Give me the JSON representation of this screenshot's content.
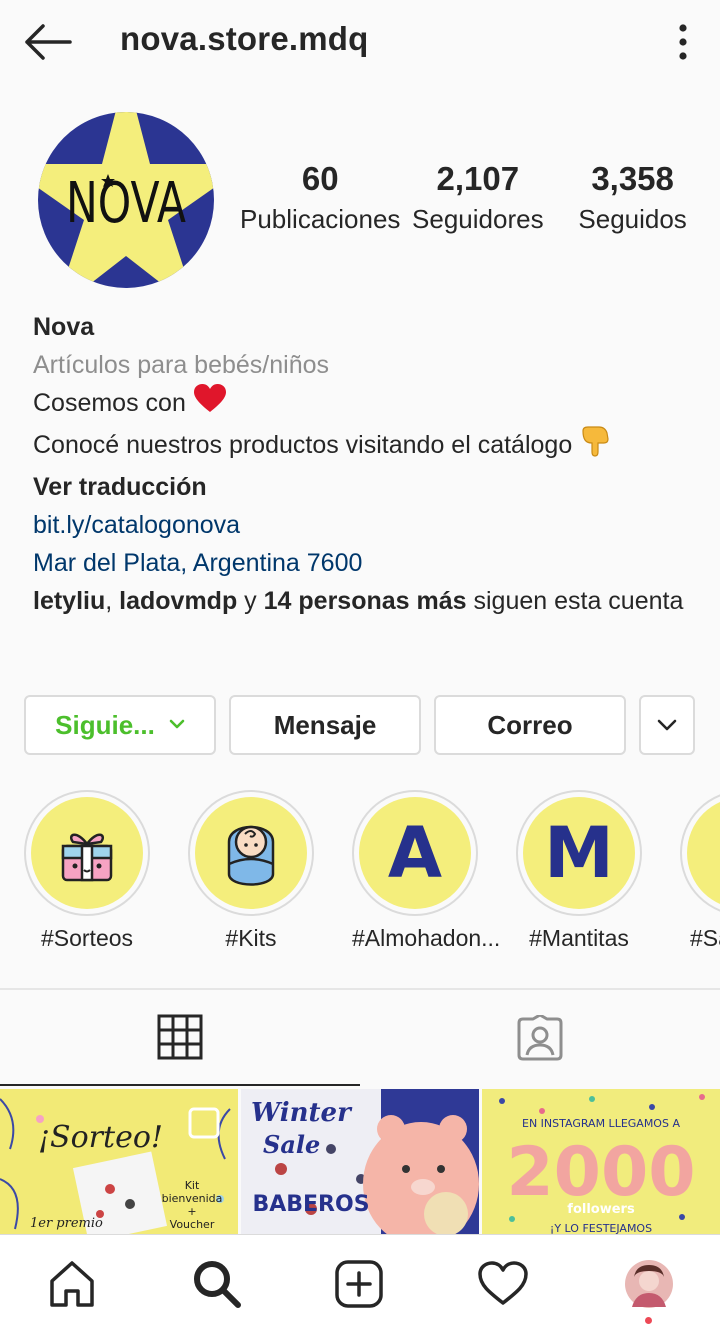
{
  "header": {
    "username": "nova.store.mdq",
    "back_icon": "arrow-left-icon",
    "menu_icon": "more-vertical-icon"
  },
  "profile": {
    "avatar_text": "NOVA",
    "stats": [
      {
        "value": "60",
        "label": "Publicaciones"
      },
      {
        "value": "2,107",
        "label": "Seguidores"
      },
      {
        "value": "3,358",
        "label": "Seguidos"
      }
    ]
  },
  "bio": {
    "name": "Nova",
    "category": "Artículos para bebés/niños",
    "line1": "Cosemos con",
    "line2": "Conocé nuestros productos visitando el catálogo",
    "translate": "Ver traducción",
    "link": "bit.ly/catalogonova",
    "location": "Mar del Plata, Argentina 7600",
    "followed_by_user1": "letyliu",
    "followed_sep1": ", ",
    "followed_by_user2": "ladovmdp",
    "followed_sep2": " y ",
    "followed_by_more": "14 personas más",
    "followed_suffix": " siguen esta cuenta"
  },
  "buttons": {
    "follow": "Siguie...",
    "message": "Mensaje",
    "email": "Correo"
  },
  "highlights": [
    {
      "label": "#Sorteos",
      "icon": "gift-icon"
    },
    {
      "label": "#Kits",
      "icon": "baby-icon"
    },
    {
      "label": "#Almohadon...",
      "letter": "A"
    },
    {
      "label": "#Mantitas",
      "letter": "M"
    },
    {
      "label": "#Sa",
      "icon": ""
    }
  ],
  "posts": [
    {
      "title": "¡Sorteo!",
      "sub1": "Kit",
      "sub2": "bienvenida",
      "sub3": "+",
      "sub4": "Voucher",
      "corner": "1er premio"
    },
    {
      "title1": "Winter",
      "title2": "Sale",
      "tag": "BABEROS"
    },
    {
      "top": "EN INSTAGRAM LLEGAMOS A",
      "big": "2000",
      "mid": "followers",
      "bottom": "¡Y LO FESTEJAMOS"
    }
  ],
  "colors": {
    "accent_green": "#4cbf2c",
    "link_blue": "#00376b",
    "brand_yellow": "#f4ee7c",
    "brand_navy": "#26318c",
    "heart_red": "#e0162b",
    "notify_dot": "#ed4956"
  }
}
